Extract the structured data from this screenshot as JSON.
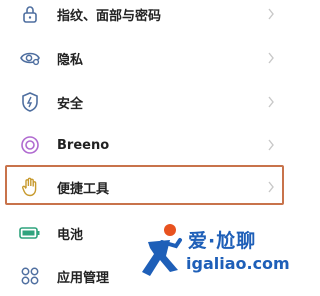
{
  "settings": {
    "items": [
      {
        "label": "指纹、面部与密码",
        "icon": "lock-icon"
      },
      {
        "label": "隐私",
        "icon": "privacy-eye-icon"
      },
      {
        "label": "安全",
        "icon": "shield-icon"
      },
      {
        "label": "Breeno",
        "icon": "breeno-icon"
      },
      {
        "label": "便捷工具",
        "icon": "hand-icon"
      },
      {
        "label": "电池",
        "icon": "battery-icon"
      },
      {
        "label": "应用管理",
        "icon": "apps-icon"
      }
    ],
    "highlighted_item": "便捷工具"
  },
  "colors": {
    "icon": "#4f6fa0",
    "highlight_border": "#c8734b",
    "chevron": "#c8c8c8",
    "watermark": "#1e5fb8",
    "watermark_accent": "#e8521f"
  },
  "watermark": {
    "brand": "爱·尬聊",
    "url": "igaliao.com"
  }
}
